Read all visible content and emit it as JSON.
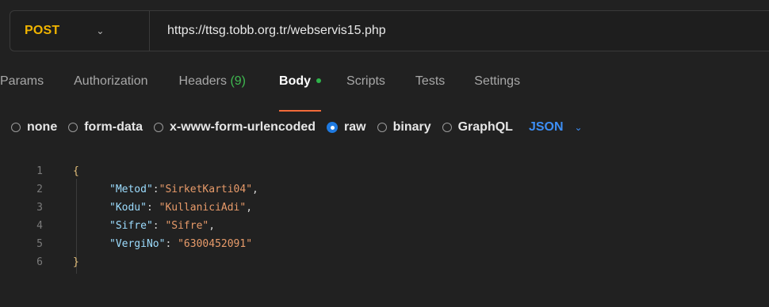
{
  "request": {
    "method": "POST",
    "url": "https://ttsg.tobb.org.tr/webservis15.php"
  },
  "tabs": [
    {
      "label": "Params"
    },
    {
      "label": "Authorization"
    },
    {
      "label": "Headers",
      "count": "(9)"
    },
    {
      "label": "Body"
    },
    {
      "label": "Scripts"
    },
    {
      "label": "Tests"
    },
    {
      "label": "Settings"
    }
  ],
  "body_types": [
    {
      "label": "none",
      "selected": false
    },
    {
      "label": "form-data",
      "selected": false
    },
    {
      "label": "x-www-form-urlencoded",
      "selected": false
    },
    {
      "label": "raw",
      "selected": true
    },
    {
      "label": "binary",
      "selected": false
    },
    {
      "label": "GraphQL",
      "selected": false
    }
  ],
  "language": "JSON",
  "editor": {
    "line_numbers": [
      "1",
      "2",
      "3",
      "4",
      "5",
      "6"
    ],
    "lines": [
      {
        "open": "{"
      },
      {
        "key": "\"Metod\"",
        "sep": ":",
        "value": "\"SirketKarti04\"",
        "end": ","
      },
      {
        "key": "\"Kodu\"",
        "sep": ": ",
        "value": "\"KullaniciAdi\"",
        "end": ","
      },
      {
        "key": "\"Sifre\"",
        "sep": ": ",
        "value": "\"Sifre\"",
        "end": ","
      },
      {
        "key": "\"VergiNo\"",
        "sep": ": ",
        "value": "\"6300452091\"",
        "end": ""
      },
      {
        "close": "}"
      }
    ]
  },
  "colors": {
    "method": "#f0b400",
    "active_tab_underline": "#f26b3a",
    "body_dot": "#2fb34a",
    "radio_selected": "#1f7ae0",
    "language": "#3d8ef5"
  }
}
